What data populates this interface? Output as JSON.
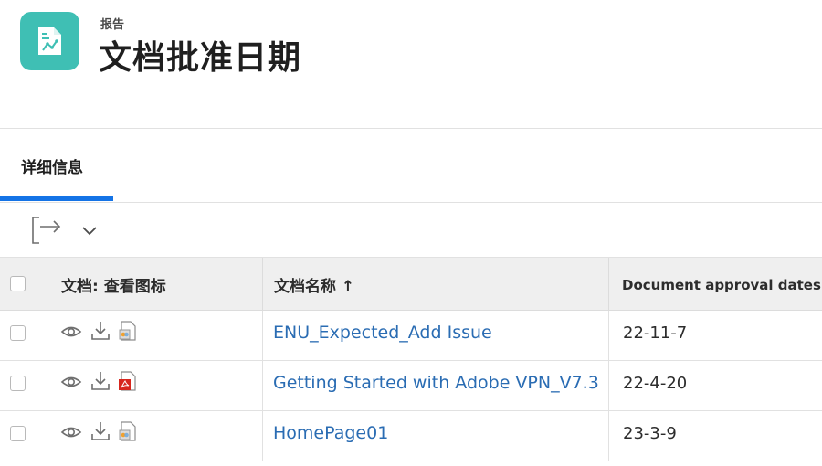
{
  "header": {
    "eyebrow": "报告",
    "title": "文档批准日期",
    "icon": "report-chart-icon",
    "icon_color": "#3fbfb4"
  },
  "tabs": [
    {
      "label": "详细信息",
      "active": true
    }
  ],
  "colors": {
    "accent": "#1473e6",
    "link": "#2a6cb3",
    "header_bg": "#efefef"
  },
  "toolbar": {
    "export_icon": "export-icon",
    "menu_icon": "chevron-down-icon"
  },
  "table": {
    "columns": [
      "文档: 查看图标",
      "文档名称 ↑",
      "Document approval dates"
    ],
    "rows": [
      {
        "file_icon": "generic-file-icon",
        "name": "ENU_Expected_Add Issue",
        "date": "22-11-7"
      },
      {
        "file_icon": "pdf-file-icon",
        "name": "Getting Started with Adobe VPN_V7.3",
        "date": "22-4-20"
      },
      {
        "file_icon": "generic-file-icon",
        "name": "HomePage01",
        "date": "23-3-9"
      }
    ]
  }
}
